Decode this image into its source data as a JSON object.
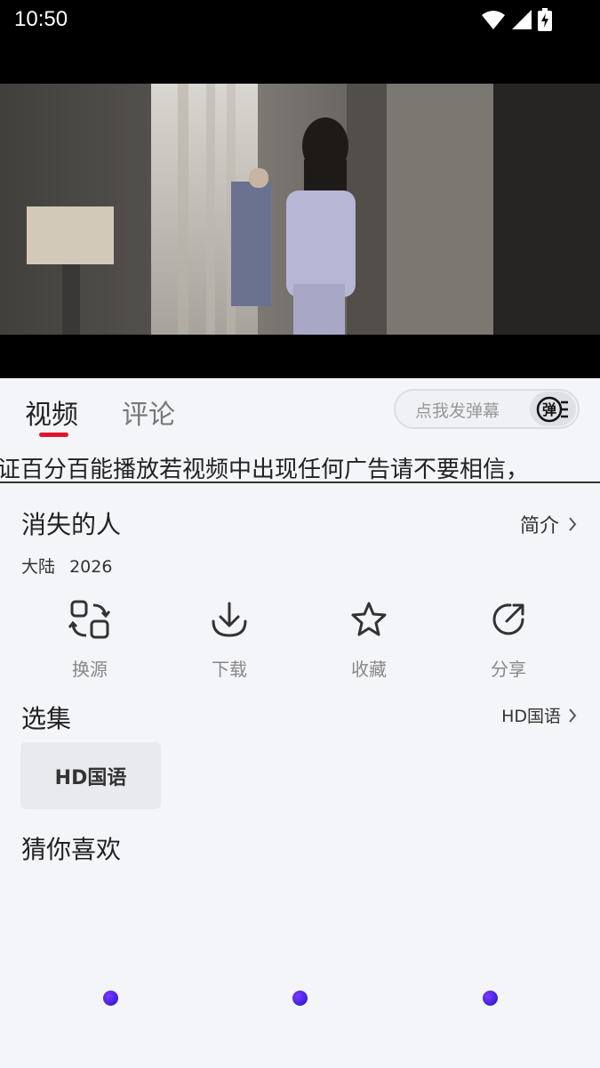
{
  "status": {
    "time": "10:50"
  },
  "tabs": [
    {
      "label": "视频"
    },
    {
      "label": "评论"
    }
  ],
  "danmaku": {
    "placeholder": "点我发弹幕",
    "toggle_glyph": "弹"
  },
  "notice": {
    "text": "证百分百能播放若视频中出现任何广告请不要相信，"
  },
  "video": {
    "title": "消失的人",
    "intro_label": "简介",
    "region": "大陆",
    "year": "2026"
  },
  "actions": [
    {
      "label": "换源",
      "icon": "switch-source-icon"
    },
    {
      "label": "下载",
      "icon": "download-icon"
    },
    {
      "label": "收藏",
      "icon": "star-icon"
    },
    {
      "label": "分享",
      "icon": "share-icon"
    }
  ],
  "episodes": {
    "section_title": "选集",
    "source_label": "HD国语",
    "items": [
      {
        "label": "HD国语"
      }
    ]
  },
  "recommend": {
    "section_title": "猜你喜欢"
  },
  "colors": {
    "accent": "#e0132e",
    "loader": "#4a2bf0"
  }
}
